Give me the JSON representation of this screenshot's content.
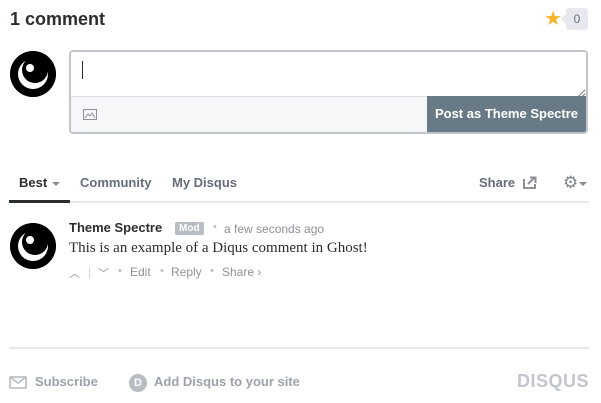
{
  "header": {
    "comment_count": "1 comment",
    "favorite_count": "0"
  },
  "composer": {
    "value": "",
    "placeholder": "",
    "post_label": "Post as Theme Spectre"
  },
  "nav": {
    "tabs": [
      {
        "label": "Best"
      },
      {
        "label": "Community"
      },
      {
        "label": "My Disqus"
      }
    ],
    "share_label": "Share"
  },
  "post": {
    "author": "Theme Spectre",
    "badge": "Mod",
    "time": "a few seconds ago",
    "body": "This is an example of a Diqus comment in Ghost!",
    "actions": {
      "edit": "Edit",
      "reply": "Reply",
      "share": "Share ›"
    }
  },
  "footer": {
    "subscribe": "Subscribe",
    "add_disqus": "Add Disqus to your site",
    "brand": "DISQUS"
  },
  "colors": {
    "accent_star": "#f5b428",
    "post_button": "#687a86",
    "text_dark": "#2a2e2e",
    "text_muted": "#656c7a"
  },
  "icons": [
    "star-icon",
    "avatar-icon",
    "image-upload-icon",
    "share-icon",
    "gear-icon",
    "mail-icon",
    "disqus-d-icon",
    "upvote-icon",
    "downvote-icon"
  ]
}
